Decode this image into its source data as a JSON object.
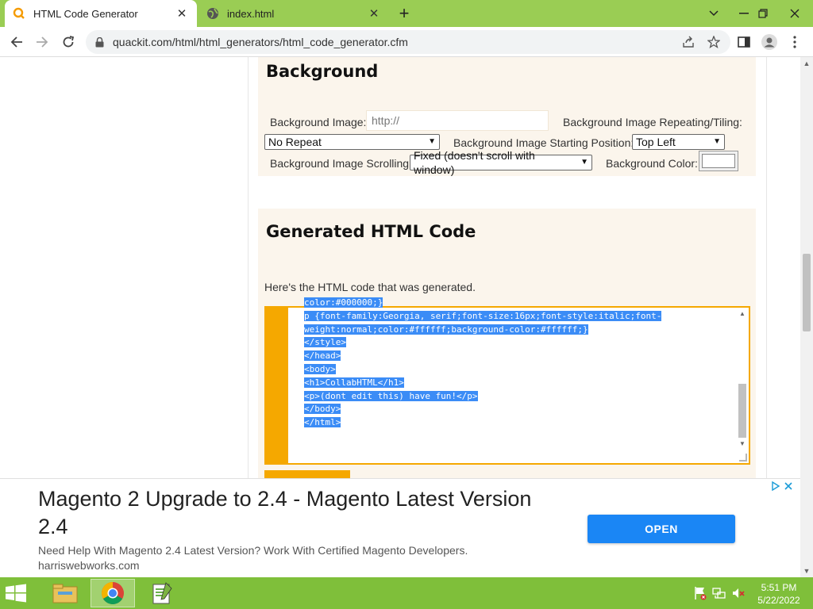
{
  "browser": {
    "tabs": [
      {
        "title": "HTML Code Generator",
        "active": true,
        "icon": "quackit-favicon"
      },
      {
        "title": "index.html",
        "active": false,
        "icon": "globe-icon"
      }
    ],
    "url": "quackit.com/html/html_generators/html_code_generator.cfm"
  },
  "background_section": {
    "heading": "Background",
    "image_label": "Background Image:",
    "image_placeholder": "http://",
    "repeat_label": "Background Image Repeating/Tiling:",
    "repeat_value": "No Repeat",
    "position_label": "Background Image Starting Position:",
    "position_value": "Top Left",
    "scroll_label": "Background Image Scrolling:",
    "scroll_value": "Fixed (doesn't scroll with window)",
    "color_label": "Background Color:"
  },
  "generated_section": {
    "heading": "Generated HTML Code",
    "intro": "Here's the HTML code that was generated.",
    "code_lines": [
      "color:#000000;}",
      "p {font-family:Georgia, serif;font-size:16px;font-style:italic;font-",
      "weight:normal;color:#ffffff;background-color:#ffffff;}",
      "</style>",
      "</head>",
      "<body>",
      "<h1>CollabHTML</h1>",
      "<p>(dont edit this) have fun!</p>",
      "</body>",
      "</html>"
    ]
  },
  "ad": {
    "headline": "Magento 2 Upgrade to 2.4 - Magento Latest Version 2.4",
    "description": "Need Help With Magento 2.4 Latest Version? Work With Certified Magento Developers.",
    "domain": "harriswebworks.com",
    "cta": "OPEN"
  },
  "taskbar": {
    "time": "5:51 PM",
    "date": "5/22/2022"
  },
  "colors": {
    "tab_strip": "#9acd54",
    "taskbar": "#7fbf3a",
    "code_border": "#f5a800",
    "selection": "#3b8cf6",
    "ad_button": "#1a86f5",
    "panel_bg": "#fbf5ec"
  }
}
